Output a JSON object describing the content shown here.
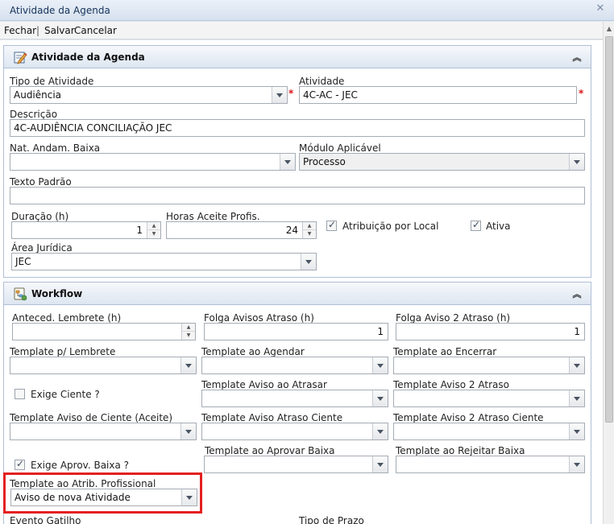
{
  "window": {
    "title": "Atividade da Agenda",
    "close_icon": "close-icon"
  },
  "toolbar": {
    "fechar": "Fechar",
    "sep": "|",
    "salvar": "Salvar",
    "cancelar": "Cancelar"
  },
  "panel1": {
    "title": "Atividade da Agenda",
    "collapse": "«",
    "tipo_atividade": {
      "label": "Tipo de Atividade",
      "value": "Audiência"
    },
    "atividade": {
      "label": "Atividade",
      "value": "4C-AC - JEC"
    },
    "descricao": {
      "label": "Descrição",
      "value": "4C-AUDIÊNCIA CONCILIAÇÃO JEC"
    },
    "nat_andam": {
      "label": "Nat. Andam. Baixa",
      "value": ""
    },
    "modulo": {
      "label": "Módulo Aplicável",
      "value": "Processo"
    },
    "texto_padrao": {
      "label": "Texto Padrão",
      "value": ""
    },
    "duracao": {
      "label": "Duração (h)",
      "value": "1"
    },
    "horas_aceite": {
      "label": "Horas Aceite Profis.",
      "value": "24"
    },
    "atribuicao_local": {
      "label": "Atribuição por Local",
      "checked": true
    },
    "ativa": {
      "label": "Ativa",
      "checked": true
    },
    "area_juridica": {
      "label": "Área Jurídica",
      "value": "JEC"
    },
    "required_mark": "*"
  },
  "panel2": {
    "title": "Workflow",
    "collapse": "«",
    "anteced_lembrete": {
      "label": "Anteced. Lembrete (h)",
      "value": ""
    },
    "folga_avisos": {
      "label": "Folga Avisos Atraso (h)",
      "value": "1"
    },
    "folga_aviso2": {
      "label": "Folga Aviso 2 Atraso (h)",
      "value": "1"
    },
    "tpl_lembrete": {
      "label": "Template p/ Lembrete",
      "value": ""
    },
    "tpl_agendar": {
      "label": "Template ao Agendar",
      "value": ""
    },
    "tpl_encerrar": {
      "label": "Template ao Encerrar",
      "value": ""
    },
    "exige_ciente": {
      "label": "Exige Ciente ?",
      "checked": false
    },
    "tpl_aviso_atrasar": {
      "label": "Template Aviso ao Atrasar",
      "value": ""
    },
    "tpl_aviso2_atraso": {
      "label": "Template Aviso 2 Atraso",
      "value": ""
    },
    "tpl_aviso_ciente": {
      "label": "Template Aviso de Ciente (Aceite)",
      "value": ""
    },
    "tpl_aviso_atraso_ciente": {
      "label": "Template Aviso Atraso Ciente",
      "value": ""
    },
    "tpl_aviso2_atraso_ciente": {
      "label": "Template Aviso 2 Atraso Ciente",
      "value": ""
    },
    "exige_aprov": {
      "label": "Exige Aprov. Baixa ?",
      "checked": true
    },
    "tpl_aprovar": {
      "label": "Template ao Aprovar Baixa",
      "value": ""
    },
    "tpl_rejeitar": {
      "label": "Template ao Rejeitar Baixa",
      "value": ""
    },
    "tpl_atrib_prof": {
      "label": "Template ao Atrib. Profissional",
      "value": "Aviso de nova Atividade"
    },
    "evento_gatilho": {
      "label": "Evento Gatilho"
    },
    "tipo_prazo": {
      "label": "Tipo de Prazo"
    }
  },
  "colors": {
    "highlight": "#e32020",
    "required": "#dd1111",
    "panel_border": "#b0bfd6"
  }
}
